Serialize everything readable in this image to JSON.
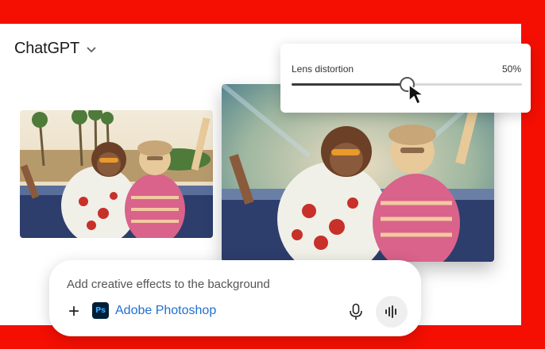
{
  "header": {
    "model_name": "ChatGPT",
    "model_icon": "chevron-down-icon"
  },
  "slider": {
    "label": "Lens distortion",
    "value_text": "50%",
    "value": 0.5
  },
  "prompt": {
    "text": "Add creative effects to the background",
    "add_icon": "plus-icon",
    "app_icon_text": "Ps",
    "app_label": "Adobe Photoshop",
    "mic_icon": "microphone-icon",
    "voice_icon": "voice-mode-icon"
  },
  "colors": {
    "brand_red": "#f40f02",
    "link_blue": "#1f6fd1",
    "ps_dark": "#001e36",
    "ps_light": "#31a8ff"
  }
}
